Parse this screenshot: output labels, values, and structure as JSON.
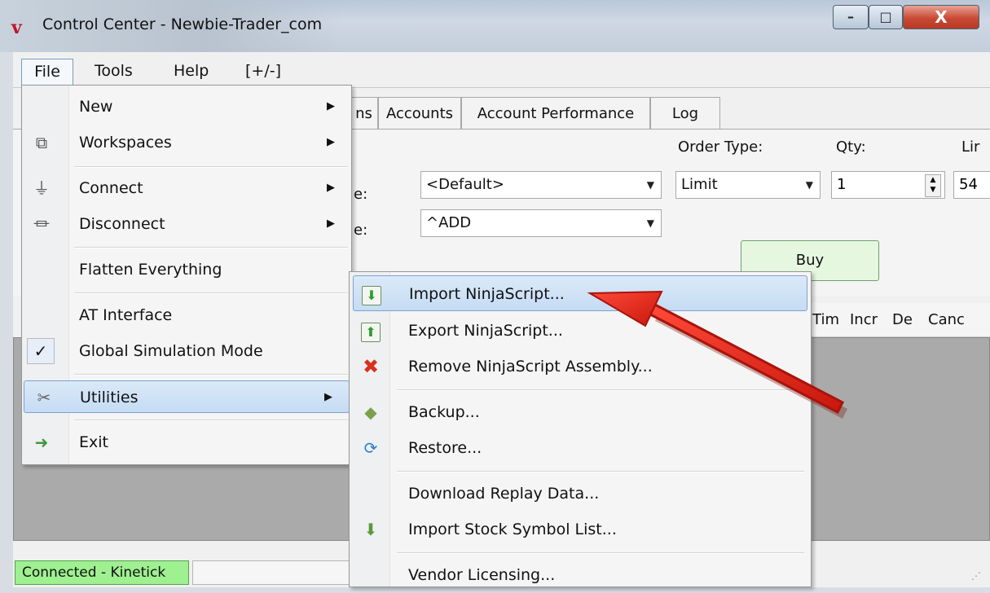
{
  "window": {
    "title": "Control Center - Newbie-Trader_com",
    "controls": {
      "minimize": "–",
      "maximize": "□",
      "close": "X"
    }
  },
  "menubar": [
    "File",
    "Tools",
    "Help",
    "[+/-]"
  ],
  "tabs": [
    "ns",
    "Accounts",
    "Account Performance",
    "Log"
  ],
  "order_panel": {
    "order_type_label": "Order Type:",
    "qty_label": "Qty:",
    "limit_label_cut": "Lir",
    "partial_label_1": "e:",
    "partial_label_2": "e:",
    "account_combo": "<Default>",
    "instrument_combo": "^ADD",
    "order_type_combo": "Limit",
    "qty_value": "1",
    "limit_value_cut": "54",
    "buy_label": "Buy"
  },
  "grid_columns": [
    "Tim",
    "Incr",
    "De",
    "Canc"
  ],
  "statusbar": {
    "connection": "Connected - Kinetick"
  },
  "file_menu": {
    "items": [
      {
        "label": "New",
        "icon": "",
        "submenu": true
      },
      {
        "label": "Workspaces",
        "icon": "workspaces-icon",
        "submenu": true
      },
      {
        "label": "Connect",
        "icon": "plug-icon",
        "submenu": true
      },
      {
        "label": "Disconnect",
        "icon": "unplug-icon",
        "submenu": true
      },
      {
        "label": "Flatten Everything",
        "icon": "",
        "submenu": false
      },
      {
        "label": "AT Interface",
        "icon": "",
        "submenu": false
      },
      {
        "label": "Global Simulation Mode",
        "icon": "checkmark-icon",
        "checked": true
      },
      {
        "label": "Utilities",
        "icon": "tools-icon",
        "submenu": true,
        "highlighted": true
      },
      {
        "label": "Exit",
        "icon": "exit-door-icon",
        "submenu": false
      }
    ]
  },
  "utilities_menu": {
    "items": [
      {
        "label": "Import NinjaScript...",
        "icon": "import-arrow-icon",
        "highlighted": true
      },
      {
        "label": "Export NinjaScript...",
        "icon": "export-arrow-icon"
      },
      {
        "label": "Remove NinjaScript Assembly...",
        "icon": "red-x-icon"
      },
      {
        "label": "Backup...",
        "icon": "backup-icon"
      },
      {
        "label": "Restore...",
        "icon": "restore-icon"
      },
      {
        "label": "Download Replay Data...",
        "icon": ""
      },
      {
        "label": "Import Stock Symbol List...",
        "icon": "import-list-icon"
      },
      {
        "label": "Vendor Licensing...",
        "icon": ""
      }
    ]
  },
  "colors": {
    "highlight": "#c5dcf4",
    "arrow_red": "#e02a1c",
    "connected_green": "#9ef090",
    "buy_green": "#e6f7e0"
  }
}
